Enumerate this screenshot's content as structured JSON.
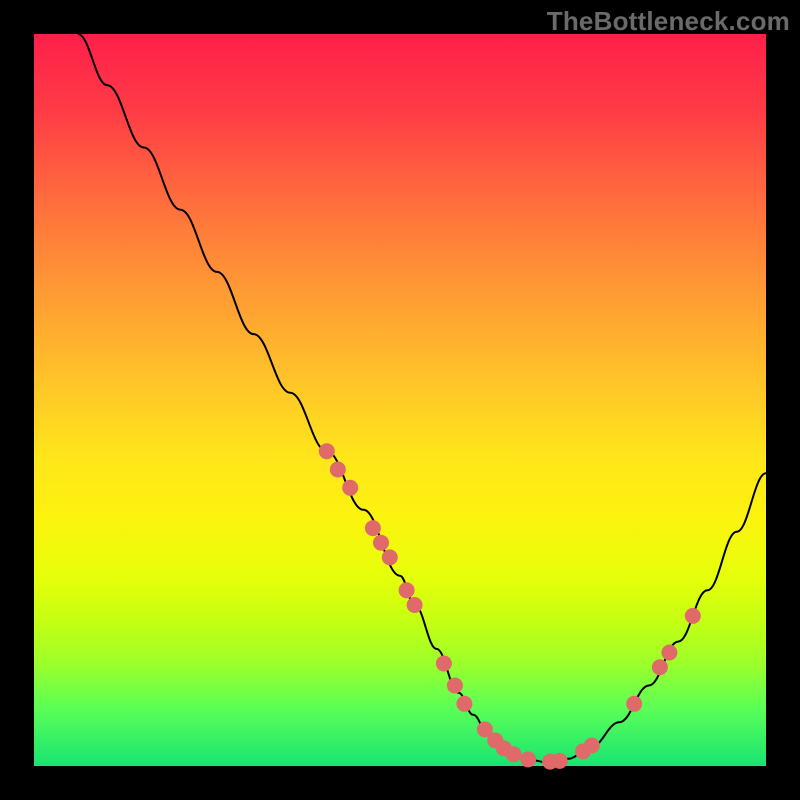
{
  "branding": {
    "text": "TheBottleneck.com"
  },
  "colors": {
    "page_bg": "#000000",
    "curve": "#000000",
    "marker": "#e06a6a",
    "gradient_stops": [
      "#ff1f4a",
      "#ff3a46",
      "#ff6a3e",
      "#ff9a34",
      "#ffc628",
      "#ffe61a",
      "#fcf30e",
      "#e6ff0a",
      "#c6ff12",
      "#9cff2a",
      "#5cff56",
      "#18e472"
    ]
  },
  "chart_data": {
    "type": "line",
    "title": "",
    "xlabel": "",
    "ylabel": "",
    "xlim": [
      0,
      100
    ],
    "ylim": [
      0,
      100
    ],
    "grid": false,
    "series": [
      {
        "name": "bottleneck-curve",
        "x": [
          6,
          10,
          15,
          20,
          25,
          30,
          35,
          40,
          45,
          50,
          52,
          55,
          58,
          60,
          62,
          65,
          68,
          70,
          73,
          76,
          80,
          84,
          88,
          92,
          96,
          100
        ],
        "y": [
          100,
          93,
          84.5,
          76,
          67.5,
          59,
          51,
          43,
          35,
          26,
          22,
          16,
          10,
          7,
          4.5,
          2,
          0.8,
          0.5,
          1,
          2.5,
          6,
          11,
          17,
          24,
          32,
          40
        ]
      }
    ],
    "markers": [
      {
        "x": 40.0,
        "y": 43.0
      },
      {
        "x": 41.5,
        "y": 40.5
      },
      {
        "x": 43.2,
        "y": 38.0
      },
      {
        "x": 46.3,
        "y": 32.5
      },
      {
        "x": 47.4,
        "y": 30.5
      },
      {
        "x": 48.6,
        "y": 28.5
      },
      {
        "x": 50.9,
        "y": 24.0
      },
      {
        "x": 52.0,
        "y": 22.0
      },
      {
        "x": 56.0,
        "y": 14.0
      },
      {
        "x": 57.5,
        "y": 11.0
      },
      {
        "x": 58.8,
        "y": 8.5
      },
      {
        "x": 61.6,
        "y": 5.0
      },
      {
        "x": 63.0,
        "y": 3.5
      },
      {
        "x": 64.2,
        "y": 2.4
      },
      {
        "x": 65.5,
        "y": 1.6
      },
      {
        "x": 67.5,
        "y": 0.9
      },
      {
        "x": 70.5,
        "y": 0.6
      },
      {
        "x": 71.8,
        "y": 0.7
      },
      {
        "x": 75.0,
        "y": 2.0
      },
      {
        "x": 76.2,
        "y": 2.8
      },
      {
        "x": 82.0,
        "y": 8.5
      },
      {
        "x": 85.5,
        "y": 13.5
      },
      {
        "x": 86.8,
        "y": 15.5
      },
      {
        "x": 90.0,
        "y": 20.5
      }
    ]
  }
}
